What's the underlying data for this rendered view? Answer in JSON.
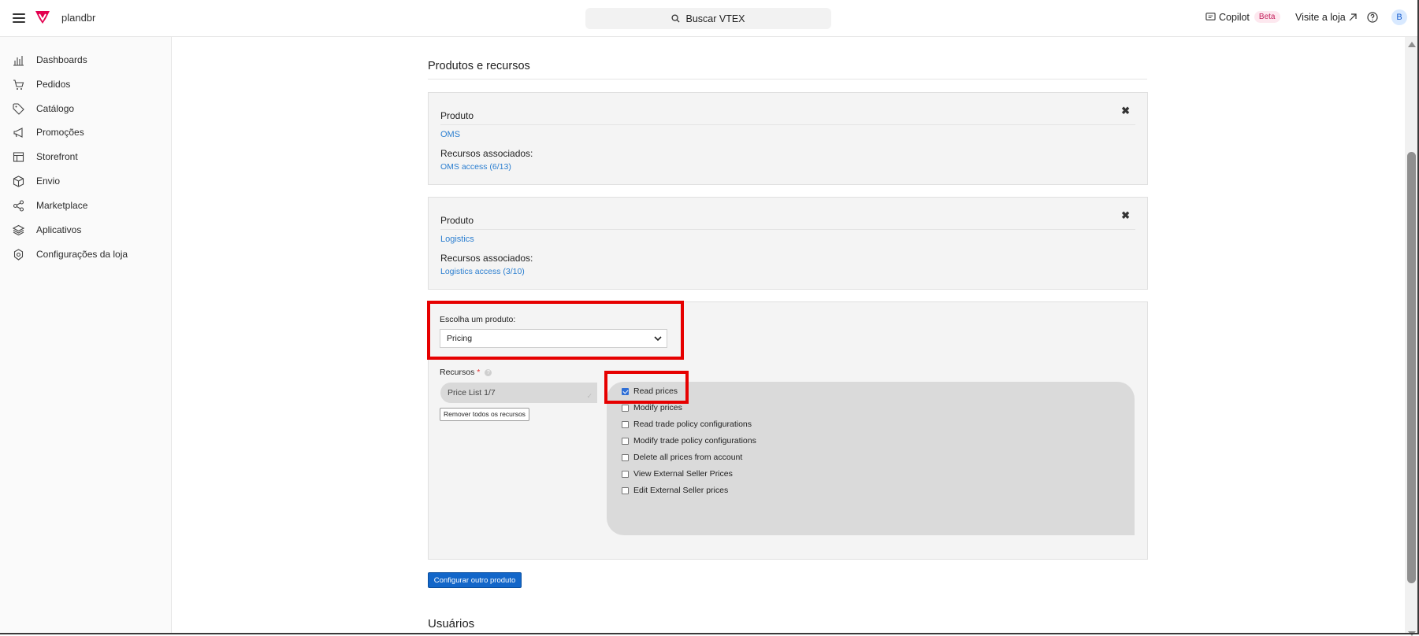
{
  "topbar": {
    "brand": "plandbr",
    "search_label": "Buscar VTEX",
    "copilot_label": "Copilot",
    "beta_badge": "Beta",
    "visit_label": "Visite a loja",
    "avatar_letter": "B"
  },
  "sidebar": {
    "items": [
      {
        "label": "Dashboards",
        "icon": "bar-chart-icon"
      },
      {
        "label": "Pedidos",
        "icon": "cart-icon"
      },
      {
        "label": "Catálogo",
        "icon": "tag-icon"
      },
      {
        "label": "Promoções",
        "icon": "megaphone-icon"
      },
      {
        "label": "Storefront",
        "icon": "layout-icon"
      },
      {
        "label": "Envio",
        "icon": "box-icon"
      },
      {
        "label": "Marketplace",
        "icon": "share-icon"
      },
      {
        "label": "Aplicativos",
        "icon": "layers-icon"
      },
      {
        "label": "Configurações da loja",
        "icon": "gear-icon"
      }
    ]
  },
  "main": {
    "section_title": "Produtos e recursos",
    "products": [
      {
        "label": "Produto",
        "name": "OMS",
        "resources_label": "Recursos associados:",
        "resources": "OMS access (6/13)"
      },
      {
        "label": "Produto",
        "name": "Logistics",
        "resources_label": "Recursos associados:",
        "resources": "Logistics access (3/10)"
      }
    ],
    "config": {
      "choose_label": "Escolha um produto:",
      "selected_product": "Pricing",
      "resources_label": "Recursos",
      "required_mark": "*",
      "help_mark": "?",
      "pill_label": "Price List 1/7",
      "remove_all_label": "Remover todos os recursos",
      "permissions": [
        {
          "label": "Read prices",
          "checked": true
        },
        {
          "label": "Modify prices",
          "checked": false
        },
        {
          "label": "Read trade policy configurations",
          "checked": false
        },
        {
          "label": "Modify trade policy configurations",
          "checked": false
        },
        {
          "label": "Delete all prices from account",
          "checked": false
        },
        {
          "label": "View External Seller Prices",
          "checked": false
        },
        {
          "label": "Edit External Seller prices",
          "checked": false
        }
      ]
    },
    "configure_other_label": "Configurar outro produto",
    "users_title": "Usuários"
  },
  "colors": {
    "accent": "#1266c9",
    "link": "#2c7fd0",
    "highlight": "#e60000",
    "brand": "#e3004f"
  }
}
